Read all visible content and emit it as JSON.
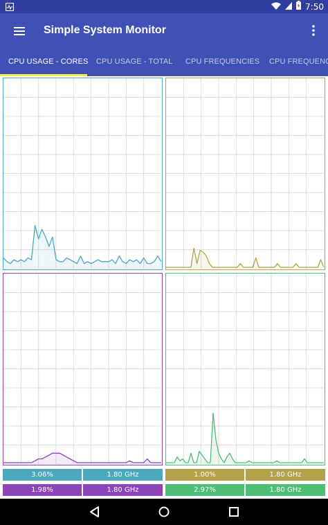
{
  "status_bar": {
    "time": "7:50",
    "icons": [
      "activity-monitor-icon",
      "wifi-icon",
      "cellular-signal-icon",
      "battery-icon"
    ]
  },
  "app_bar": {
    "title": "Simple System Monitor",
    "menu_icon": "hamburger-menu-icon",
    "overflow_icon": "more-vert-icon"
  },
  "tabs": [
    {
      "label": "CPU USAGE - CORES",
      "active": true
    },
    {
      "label": "CPU USAGE - TOTAL",
      "active": false
    },
    {
      "label": "CPU FREQUENCIES",
      "active": false
    },
    {
      "label": "CPU FREQUENCY",
      "active": false
    }
  ],
  "colors": {
    "primary": "#3f51b5",
    "primary_dark": "#303f9f",
    "accent": "#ffeb3b",
    "core0": "#4ba8bd",
    "core1": "#b4a24a",
    "core2": "#8d44b8",
    "core3": "#4cbe75"
  },
  "cores": [
    {
      "usage": "3.06%",
      "frequency": "1.80 GHz",
      "color": "#4ba8bd",
      "samples": [
        5,
        3,
        2,
        4,
        3,
        4,
        3,
        5,
        4,
        22,
        15,
        20,
        16,
        11,
        16,
        4,
        3,
        3,
        5,
        4,
        3,
        2,
        6,
        2,
        3,
        2,
        3,
        4,
        3,
        3,
        3,
        4,
        2,
        6,
        3,
        2,
        4,
        3,
        4,
        2,
        5,
        2,
        2,
        3,
        6,
        3
      ]
    },
    {
      "usage": "1.00%",
      "frequency": "1.80 GHz",
      "color": "#b4a24a",
      "samples": [
        0,
        0,
        0,
        0,
        0,
        0,
        0,
        0,
        0,
        10,
        2,
        9,
        8,
        6,
        2,
        0,
        0,
        0,
        0,
        0,
        0,
        0,
        0,
        0,
        2,
        0,
        0,
        0,
        0,
        5,
        0,
        0,
        0,
        0,
        0,
        0,
        2,
        0,
        0,
        0,
        0,
        0,
        2,
        0,
        0,
        0,
        0,
        0,
        0,
        0,
        4,
        0
      ]
    },
    {
      "usage": "1.98%",
      "frequency": "1.80 GHz",
      "color": "#8d44b8",
      "samples": [
        0,
        0,
        0,
        0,
        0,
        0,
        0,
        0,
        0,
        1,
        2,
        2,
        3,
        4,
        5,
        5,
        5,
        4,
        3,
        2,
        1,
        0,
        0,
        0,
        0,
        0,
        0,
        0,
        0,
        0,
        0,
        0,
        0,
        0,
        0,
        0,
        1,
        0,
        0,
        0,
        0,
        2,
        0,
        0,
        0,
        0
      ]
    },
    {
      "usage": "2.97%",
      "frequency": "1.80 GHz",
      "color": "#4cbe75",
      "samples": [
        0,
        0,
        0,
        0,
        3,
        1,
        2,
        0,
        0,
        5,
        0,
        0,
        6,
        4,
        2,
        0,
        0,
        26,
        12,
        5,
        2,
        0,
        3,
        5,
        2,
        0,
        0,
        0,
        0,
        0,
        1,
        0,
        0,
        0,
        0,
        0,
        0,
        0,
        0,
        0,
        1,
        0,
        0,
        0,
        0,
        0,
        0,
        0,
        0,
        0,
        2,
        0,
        0,
        0,
        0,
        0,
        0,
        0
      ]
    }
  ],
  "nav_bar": {
    "back_icon": "back-triangle-icon",
    "home_icon": "home-circle-icon",
    "recents_icon": "recents-square-icon"
  }
}
